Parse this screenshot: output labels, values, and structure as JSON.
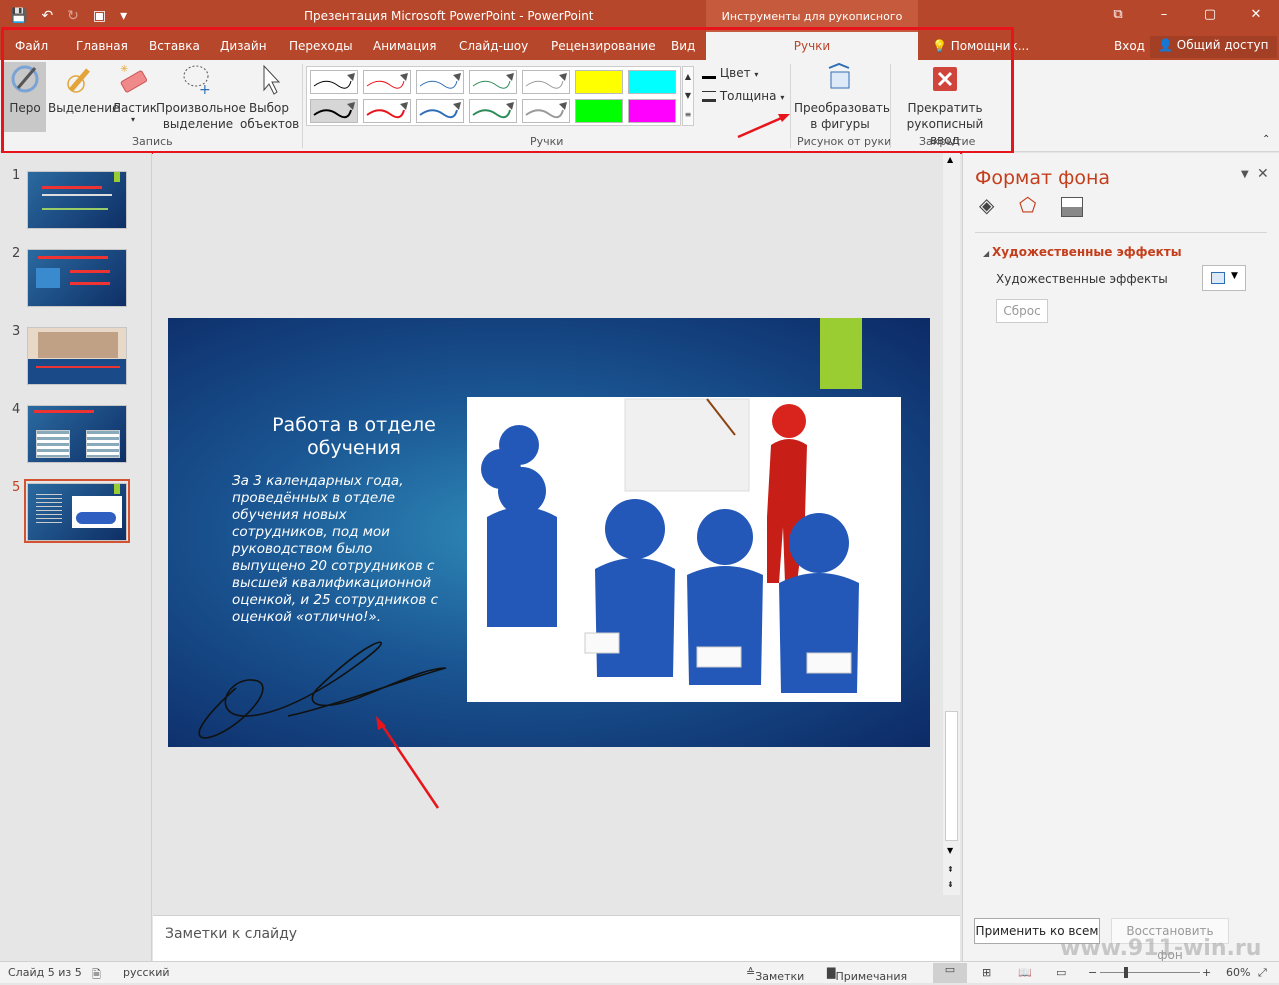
{
  "window": {
    "title": "Презентация Microsoft PowerPoint - PowerPoint",
    "context_tab": "Инструменты для рукописного ввода",
    "controls": [
      "⧉",
      "–",
      "▢",
      "✕"
    ]
  },
  "tabs": [
    "Файл",
    "Главная",
    "Вставка",
    "Дизайн",
    "Переходы",
    "Анимация",
    "Слайд-шоу",
    "Рецензирование",
    "Вид",
    "Ручки"
  ],
  "active_tab": "Ручки",
  "tell_me": "Помощник...",
  "signin": "Вход",
  "share": "Общий доступ",
  "ribbon": {
    "pen": "Перо",
    "highlighter": "Выделение",
    "eraser": "Ластик",
    "lasso_line1": "Произвольное",
    "lasso_line2": "выделение",
    "select_line1": "Выбор",
    "select_line2": "объектов",
    "group_record": "Запись",
    "group_pens": "Ручки",
    "color": "Цвет",
    "thickness": "Толщина",
    "convert_line1": "Преобразовать",
    "convert_line2": "в фигуры",
    "group_drawing": "Рисунок от руки",
    "stop_line1": "Прекратить",
    "stop_line2": "рукописный ввод",
    "group_close": "Закрытие"
  },
  "pen_colors": [
    "#000000",
    "#e8141b",
    "#2f6fb5",
    "#2e8b57",
    "#999999",
    "#ffff00",
    "#00ffff",
    "#000000",
    "#e8141b",
    "#2f6fb5",
    "#2e8b57",
    "#999999",
    "#00ff00",
    "#ff00ff"
  ],
  "slides": [
    {
      "num": "1"
    },
    {
      "num": "2"
    },
    {
      "num": "3"
    },
    {
      "num": "4"
    },
    {
      "num": "5"
    }
  ],
  "current_slide": {
    "title": "Работа в отделе обучения",
    "body": "За 3 календарных года, проведённых в отделе обучения новых сотрудников, под мои руководством было выпущено 20 сотрудников с высшей квалификационной оценкой, и 25 сотрудников с оценкой «отлично!»."
  },
  "notes_placeholder": "Заметки к слайду",
  "format_pane": {
    "title": "Формат фона",
    "section": "Художественные эффекты",
    "row_label": "Художественные эффекты",
    "reset": "Сброс",
    "apply_all": "Применить ко всем",
    "restore": "Восстановить фон"
  },
  "status": {
    "slide": "Слайд 5 из 5",
    "language": "русский",
    "notes": "Заметки",
    "comments": "Примечания",
    "zoom": "60%"
  },
  "watermark": "www.911-win.ru"
}
